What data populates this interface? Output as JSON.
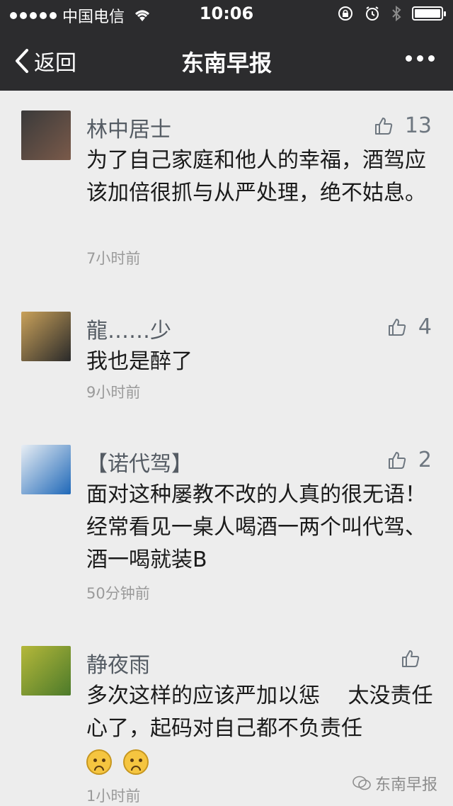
{
  "status_bar": {
    "carrier": "中国电信",
    "time": "10:06",
    "battery_level": 1.0
  },
  "nav": {
    "back_label": "返回",
    "title": "东南早报",
    "more_icon": "more-dots-icon"
  },
  "comments": [
    {
      "name": "林中居士",
      "likes": "13",
      "text": "为了自己家庭和他人的幸福，酒驾应该加倍很抓与从严处理，绝不姑息。",
      "time": "7小时前",
      "avatar_colors": [
        "#3a3a3a",
        "#7a5a4a"
      ]
    },
    {
      "name": "龍……少",
      "likes": "4",
      "text": "我也是醉了",
      "time": "9小时前",
      "avatar_colors": [
        "#c9a15a",
        "#2a2a2a"
      ]
    },
    {
      "name": "【诺代驾】",
      "likes": "2",
      "text": "面对这种屡教不改的人真的很无语！经常看见一桌人喝酒一两个叫代驾、酒一喝就装B",
      "time": "50分钟前",
      "avatar_colors": [
        "#e8eef4",
        "#1f68b8"
      ]
    },
    {
      "name": "静夜雨",
      "likes": "",
      "text": "多次这样的应该严加以惩　 太没责任心了，起码对自己都不负责任",
      "time": "1小时前",
      "avatar_colors": [
        "#b5b83a",
        "#4c7a2a"
      ]
    }
  ],
  "watermark": {
    "label": "东南早报"
  }
}
